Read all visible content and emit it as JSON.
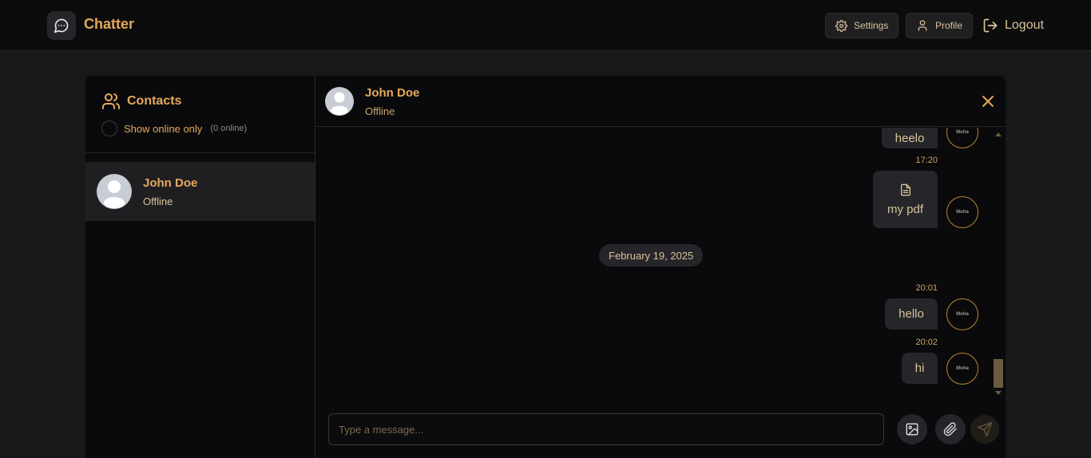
{
  "app": {
    "name": "Chatter"
  },
  "nav": {
    "settings_label": "Settings",
    "profile_label": "Profile",
    "logout_label": "Logout"
  },
  "sidebar": {
    "title": "Contacts",
    "online_toggle_label": "Show online only",
    "online_count": "(0 online)",
    "contacts": [
      {
        "name": "John Doe",
        "status": "Offline"
      }
    ]
  },
  "chat": {
    "contact_name": "John Doe",
    "contact_status": "Offline",
    "messages": [
      {
        "text": "heelo",
        "time": ""
      },
      {
        "text": "my pdf",
        "time": "17:20",
        "attachment_icon": "file-icon"
      },
      {
        "text": "hello",
        "time": "20:01"
      },
      {
        "text": "hi",
        "time": "20:02"
      }
    ],
    "date_separator": "February 19, 2025",
    "avatar_text": "Moha",
    "input_placeholder": "Type a message..."
  },
  "colors": {
    "accent": "#e5a95c",
    "background": "#18181b",
    "panel": "#0a0a0c",
    "bubble": "#26262a"
  }
}
